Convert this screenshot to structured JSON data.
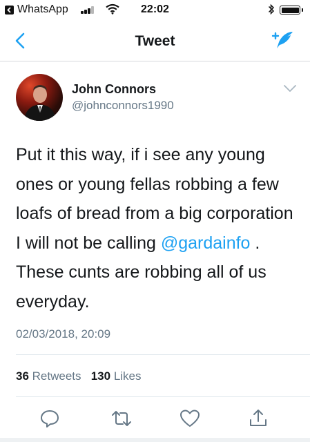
{
  "status_bar": {
    "back_app": "WhatsApp",
    "time": "22:02"
  },
  "nav": {
    "title": "Tweet",
    "accent_color": "#1da1f2"
  },
  "tweet": {
    "author_name": "John Connors",
    "author_handle": "@johnconnors1990",
    "text_before_mention": "Put it this way, if i see any young ones or young fellas robbing a few loafs of bread from a big corporation I will not be calling ",
    "mention": "@gardainfo",
    "text_after_mention": " . These cunts are robbing all of us everyday.",
    "timestamp": "02/03/2018, 20:09"
  },
  "stats": {
    "retweets_count": "36",
    "retweets_label": "Retweets",
    "likes_count": "130",
    "likes_label": "Likes"
  },
  "actions": [
    {
      "icon": "reply-icon"
    },
    {
      "icon": "retweet-icon"
    },
    {
      "icon": "like-icon"
    },
    {
      "icon": "share-icon"
    }
  ]
}
